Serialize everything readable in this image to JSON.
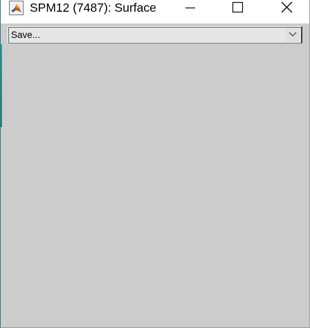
{
  "window": {
    "title": "SPM12 (7487): Surface",
    "icon": "matlab-icon",
    "controls": [
      "minimize-icon",
      "maximize-icon",
      "close-icon"
    ]
  },
  "toolbar": {
    "dropdown": {
      "selected": "Save..."
    }
  },
  "colors": {
    "figure_background": "#cccccc",
    "titlebar_background": "#ffffff"
  }
}
